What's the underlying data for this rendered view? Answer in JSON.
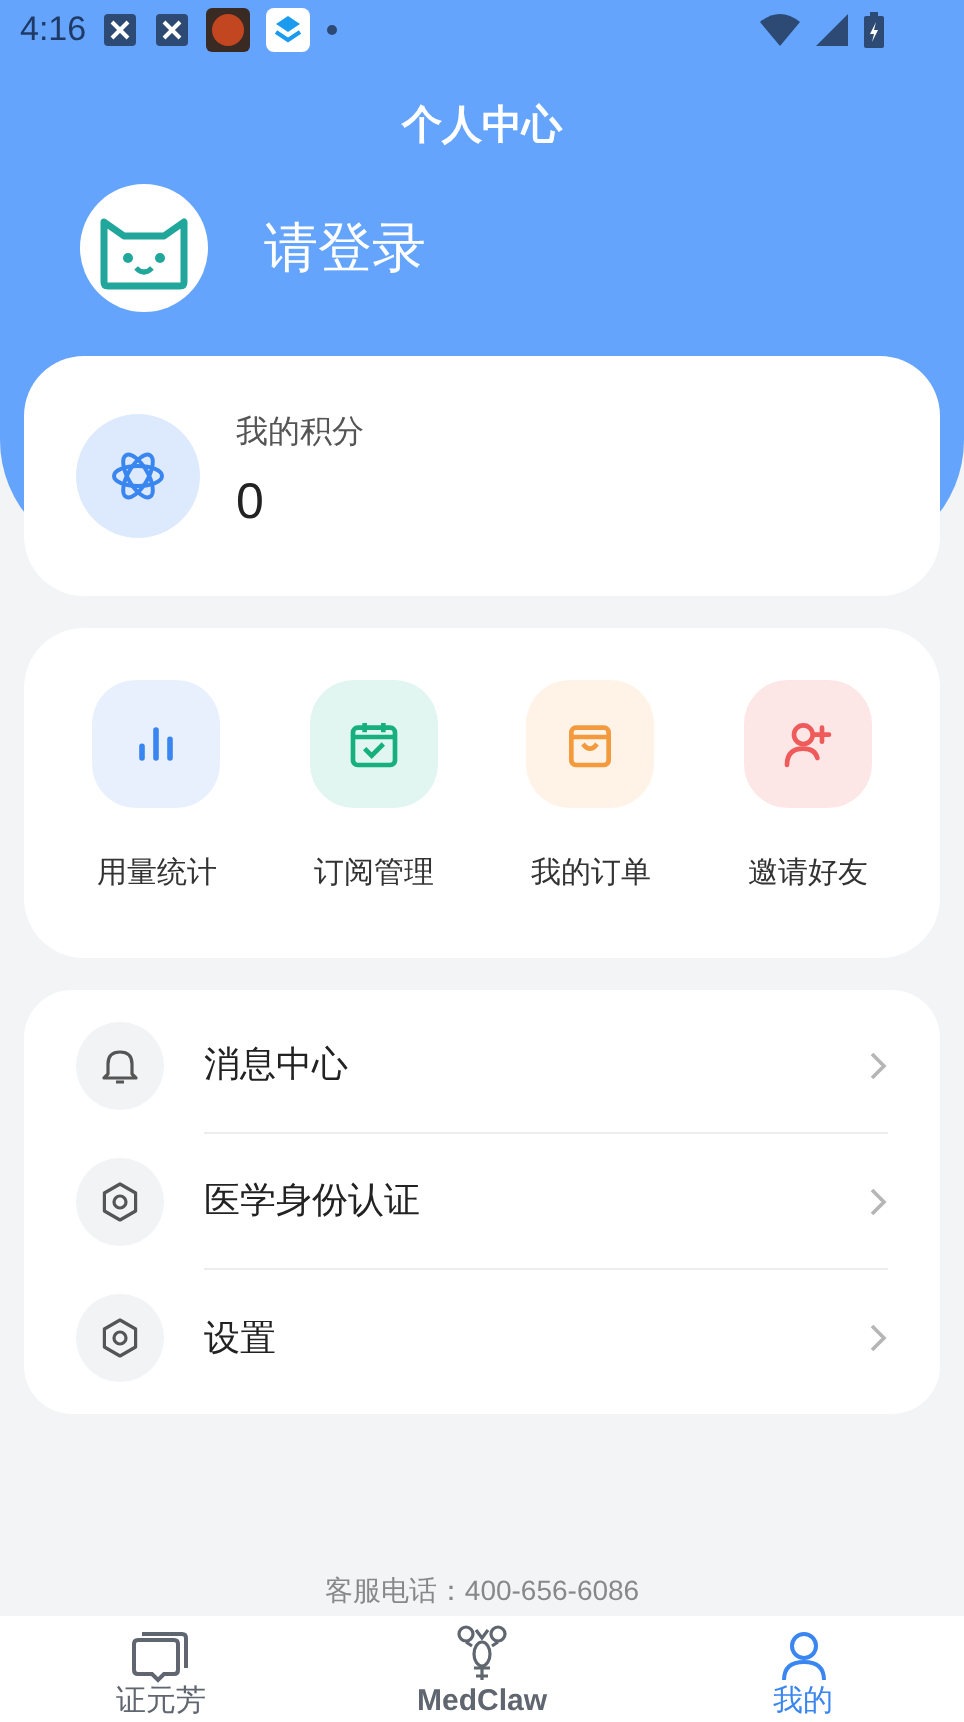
{
  "status_bar": {
    "time": "4:16"
  },
  "header": {
    "title": "个人中心",
    "login_prompt": "请登录"
  },
  "points": {
    "label": "我的积分",
    "value": "0"
  },
  "shortcuts": [
    {
      "kind": "stats",
      "label": "用量统计"
    },
    {
      "kind": "subscription",
      "label": "订阅管理"
    },
    {
      "kind": "orders",
      "label": "我的订单"
    },
    {
      "kind": "invite",
      "label": "邀请好友"
    }
  ],
  "menu": [
    {
      "kind": "bell",
      "label": "消息中心"
    },
    {
      "kind": "gear",
      "label": "医学身份认证"
    },
    {
      "kind": "gear",
      "label": "设置"
    }
  ],
  "hotline": "客服电话：400-656-6086",
  "tabs": [
    {
      "kind": "chat",
      "label": "证元芳",
      "selected": false
    },
    {
      "kind": "claw",
      "label": "MedClaw",
      "selected": false
    },
    {
      "kind": "person",
      "label": "我的",
      "selected": true
    }
  ]
}
